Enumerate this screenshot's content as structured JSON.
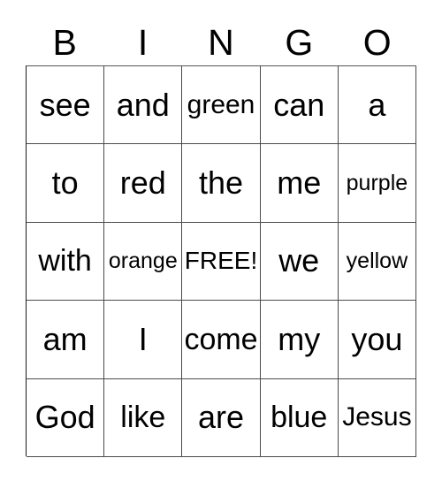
{
  "card": {
    "title": "BINGO",
    "headers": [
      "B",
      "I",
      "N",
      "G",
      "O"
    ],
    "rows": [
      {
        "cells": [
          {
            "text": "see"
          },
          {
            "text": "and"
          },
          {
            "text": "green"
          },
          {
            "text": "can"
          },
          {
            "text": "a"
          }
        ]
      },
      {
        "cells": [
          {
            "text": "to"
          },
          {
            "text": "red"
          },
          {
            "text": "the"
          },
          {
            "text": "me"
          },
          {
            "text": "purple"
          }
        ]
      },
      {
        "cells": [
          {
            "text": "with"
          },
          {
            "text": "orange"
          },
          {
            "text": "FREE!"
          },
          {
            "text": "we"
          },
          {
            "text": "yellow"
          }
        ]
      },
      {
        "cells": [
          {
            "text": "am"
          },
          {
            "text": "I"
          },
          {
            "text": "come"
          },
          {
            "text": "my"
          },
          {
            "text": "you"
          }
        ]
      },
      {
        "cells": [
          {
            "text": "God"
          },
          {
            "text": "like"
          },
          {
            "text": "are"
          },
          {
            "text": "blue"
          },
          {
            "text": "Jesus"
          }
        ]
      }
    ],
    "colors": {
      "text": "#000000",
      "border": "#4a4a4a",
      "background": "#ffffff"
    }
  }
}
